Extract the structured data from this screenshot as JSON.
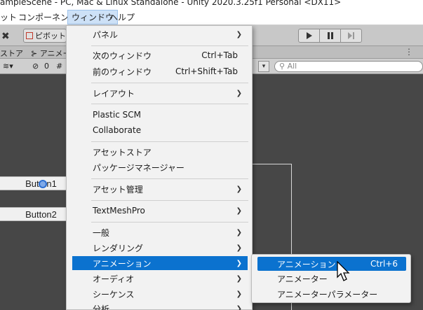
{
  "window": {
    "title": "ampleScene - PC, Mac & Linux Standalone - Unity 2020.3.25f1 Personal <DX11>"
  },
  "menubar": {
    "items": [
      "ット",
      "コンポーネント",
      "ウィンドウ",
      "ヘルプ"
    ]
  },
  "toolbar": {
    "pivot_label": "ピボット"
  },
  "tabs": {
    "left": "ストア",
    "animator": "アニメー"
  },
  "scenebar": {
    "layers_count": "0",
    "search_placeholder": "All"
  },
  "scene": {
    "button1": "Button1",
    "button2": "Button2"
  },
  "window_menu": {
    "panels": "パネル",
    "next_window": "次のウィンドウ",
    "next_window_shortcut": "Ctrl+Tab",
    "prev_window": "前のウィンドウ",
    "prev_window_shortcut": "Ctrl+Shift+Tab",
    "layout": "レイアウト",
    "plastic_scm": "Plastic SCM",
    "collaborate": "Collaborate",
    "asset_store": "アセットストア",
    "package_manager": "パッケージマネージャー",
    "asset_management": "アセット管理",
    "textmeshpro": "TextMeshPro",
    "general": "一般",
    "rendering": "レンダリング",
    "animation": "アニメーション",
    "audio": "オーディオ",
    "sequence": "シーケンス",
    "analysis": "分析"
  },
  "animation_submenu": {
    "animation": "アニメーション",
    "animation_shortcut": "Ctrl+6",
    "animator": "アニメーター",
    "animator_parameter": "アニメーターパラメーター"
  },
  "colors": {
    "highlight": "#0b72cf",
    "menu_bg": "#f2f2f2",
    "scene_bg": "#474747"
  }
}
